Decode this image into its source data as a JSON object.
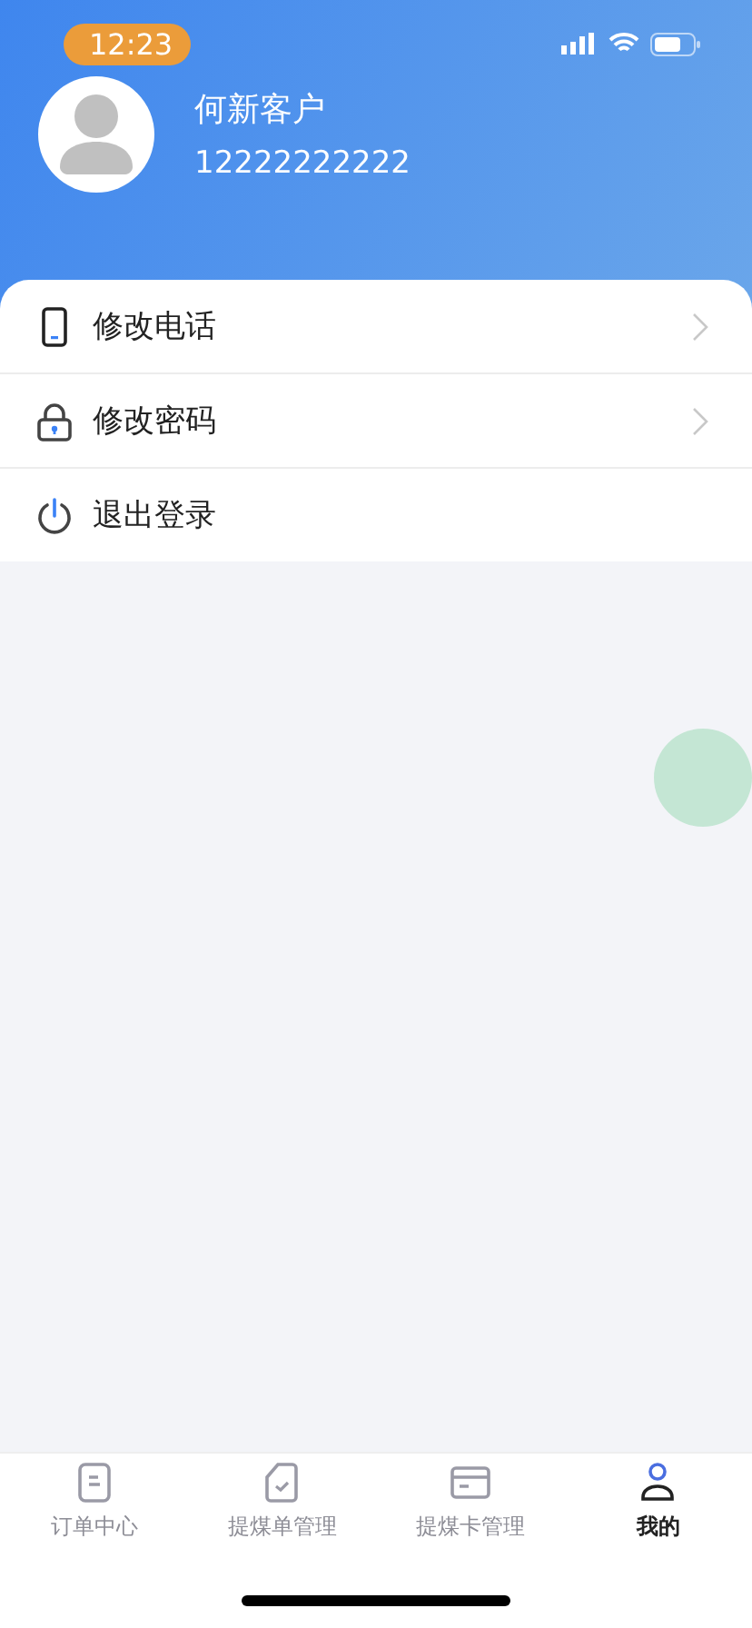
{
  "status_bar": {
    "time": "12:23"
  },
  "profile": {
    "name": "何新客户",
    "phone": "12222222222"
  },
  "menu": [
    {
      "kind": "phone",
      "label": "修改电话",
      "arrow": true
    },
    {
      "kind": "lock",
      "label": "修改密码",
      "arrow": true
    },
    {
      "kind": "power",
      "label": "退出登录",
      "arrow": false
    }
  ],
  "tabs": [
    {
      "kind": "order",
      "label": "订单中心",
      "selected": false
    },
    {
      "kind": "bill",
      "label": "提煤单管理",
      "selected": false
    },
    {
      "kind": "card",
      "label": "提煤卡管理",
      "selected": false
    },
    {
      "kind": "user",
      "label": "我的",
      "selected": true
    }
  ]
}
